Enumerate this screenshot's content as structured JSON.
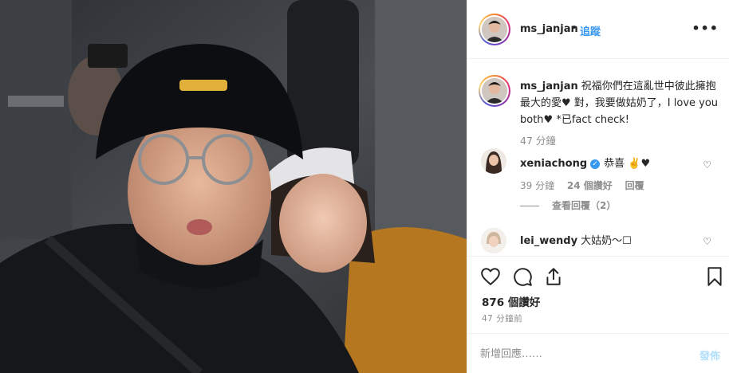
{
  "post": {
    "photo_alt": "selfie-photo",
    "header": {
      "username": "ms_janjan",
      "separator": "•",
      "follow_label": "追蹤",
      "more_label": "•••"
    },
    "caption": {
      "username": "ms_janjan",
      "text": "祝福你們在這亂世中彼此擁抱最大的愛♥ 對，我要做姑奶了，I love you both♥ *已fact check!",
      "time": "47 分鐘"
    },
    "comments": [
      {
        "username": "xeniachong",
        "text": "恭喜 ✌️♥",
        "time": "39 分鐘",
        "likes": "24 個讚好",
        "reply_label": "回覆",
        "view_replies": "查看回覆（2）"
      },
      {
        "username": "lei_wendy",
        "text": "大姑奶～☐"
      }
    ],
    "likes_text": "876 個讚好",
    "post_time": "47 分鐘前",
    "comment_input": {
      "placeholder": "新增回應……",
      "post_label": "發佈"
    },
    "colors": {
      "accent": "#3897f0",
      "post_disabled": "#b2dffc",
      "muted": "#8e8e8e"
    }
  }
}
